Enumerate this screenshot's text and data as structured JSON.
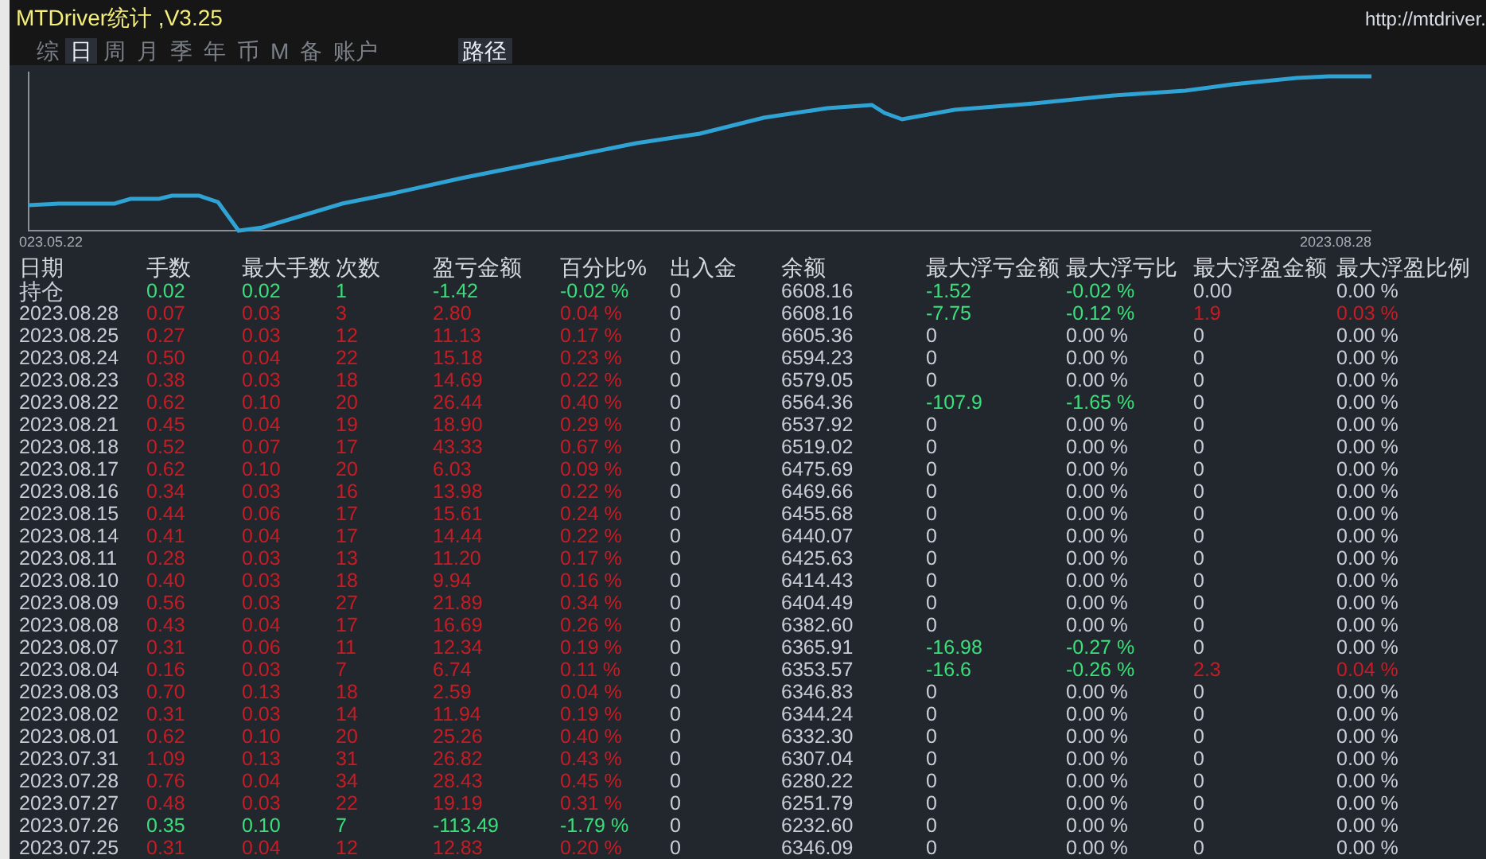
{
  "window": {
    "title": "MTDriver统计 ,V3.25",
    "url": "http://mtdriver."
  },
  "tabs": [
    {
      "label": "综",
      "selected": false
    },
    {
      "label": "日",
      "selected": true
    },
    {
      "label": "周",
      "selected": false
    },
    {
      "label": "月",
      "selected": false
    },
    {
      "label": "季",
      "selected": false
    },
    {
      "label": "年",
      "selected": false
    },
    {
      "label": "币",
      "selected": false
    },
    {
      "label": "M",
      "selected": false
    },
    {
      "label": "备",
      "selected": false
    },
    {
      "label": "账户",
      "selected": false
    }
  ],
  "path_button": "路径",
  "chart": {
    "start_label": "023.05.22",
    "end_label": "2023.08.28"
  },
  "table": {
    "columns": [
      "日期",
      "手数",
      "最大手数",
      "次数",
      "盈亏金额",
      "百分比%",
      "出入金",
      "余额",
      "最大浮亏金额",
      "最大浮亏比",
      "最大浮盈金额",
      "最大浮盈比例"
    ],
    "rows": [
      {
        "cells": [
          "持仓",
          "0.02",
          "0.02",
          "1",
          "-1.42",
          "-0.02 %",
          "0",
          "6608.16",
          "-1.52",
          "-0.02 %",
          "0.00",
          "0.00 %"
        ],
        "loss": true,
        "float_loss": true,
        "float_profit": false
      },
      {
        "cells": [
          "2023.08.28",
          "0.07",
          "0.03",
          "3",
          "2.80",
          "0.04 %",
          "0",
          "6608.16",
          "-7.75",
          "-0.12 %",
          "1.9",
          "0.03 %"
        ],
        "loss": false,
        "float_loss": true,
        "float_profit": true
      },
      {
        "cells": [
          "2023.08.25",
          "0.27",
          "0.03",
          "12",
          "11.13",
          "0.17 %",
          "0",
          "6605.36",
          "0",
          "0.00 %",
          "0",
          "0.00 %"
        ],
        "loss": false,
        "float_loss": false,
        "float_profit": false
      },
      {
        "cells": [
          "2023.08.24",
          "0.50",
          "0.04",
          "22",
          "15.18",
          "0.23 %",
          "0",
          "6594.23",
          "0",
          "0.00 %",
          "0",
          "0.00 %"
        ],
        "loss": false,
        "float_loss": false,
        "float_profit": false
      },
      {
        "cells": [
          "2023.08.23",
          "0.38",
          "0.03",
          "18",
          "14.69",
          "0.22 %",
          "0",
          "6579.05",
          "0",
          "0.00 %",
          "0",
          "0.00 %"
        ],
        "loss": false,
        "float_loss": false,
        "float_profit": false
      },
      {
        "cells": [
          "2023.08.22",
          "0.62",
          "0.10",
          "20",
          "26.44",
          "0.40 %",
          "0",
          "6564.36",
          "-107.9",
          "-1.65 %",
          "0",
          "0.00 %"
        ],
        "loss": false,
        "float_loss": true,
        "float_profit": false
      },
      {
        "cells": [
          "2023.08.21",
          "0.45",
          "0.04",
          "19",
          "18.90",
          "0.29 %",
          "0",
          "6537.92",
          "0",
          "0.00 %",
          "0",
          "0.00 %"
        ],
        "loss": false,
        "float_loss": false,
        "float_profit": false
      },
      {
        "cells": [
          "2023.08.18",
          "0.52",
          "0.07",
          "17",
          "43.33",
          "0.67 %",
          "0",
          "6519.02",
          "0",
          "0.00 %",
          "0",
          "0.00 %"
        ],
        "loss": false,
        "float_loss": false,
        "float_profit": false
      },
      {
        "cells": [
          "2023.08.17",
          "0.62",
          "0.10",
          "20",
          "6.03",
          "0.09 %",
          "0",
          "6475.69",
          "0",
          "0.00 %",
          "0",
          "0.00 %"
        ],
        "loss": false,
        "float_loss": false,
        "float_profit": false
      },
      {
        "cells": [
          "2023.08.16",
          "0.34",
          "0.03",
          "16",
          "13.98",
          "0.22 %",
          "0",
          "6469.66",
          "0",
          "0.00 %",
          "0",
          "0.00 %"
        ],
        "loss": false,
        "float_loss": false,
        "float_profit": false
      },
      {
        "cells": [
          "2023.08.15",
          "0.44",
          "0.06",
          "17",
          "15.61",
          "0.24 %",
          "0",
          "6455.68",
          "0",
          "0.00 %",
          "0",
          "0.00 %"
        ],
        "loss": false,
        "float_loss": false,
        "float_profit": false
      },
      {
        "cells": [
          "2023.08.14",
          "0.41",
          "0.04",
          "17",
          "14.44",
          "0.22 %",
          "0",
          "6440.07",
          "0",
          "0.00 %",
          "0",
          "0.00 %"
        ],
        "loss": false,
        "float_loss": false,
        "float_profit": false
      },
      {
        "cells": [
          "2023.08.11",
          "0.28",
          "0.03",
          "13",
          "11.20",
          "0.17 %",
          "0",
          "6425.63",
          "0",
          "0.00 %",
          "0",
          "0.00 %"
        ],
        "loss": false,
        "float_loss": false,
        "float_profit": false
      },
      {
        "cells": [
          "2023.08.10",
          "0.40",
          "0.03",
          "18",
          "9.94",
          "0.16 %",
          "0",
          "6414.43",
          "0",
          "0.00 %",
          "0",
          "0.00 %"
        ],
        "loss": false,
        "float_loss": false,
        "float_profit": false
      },
      {
        "cells": [
          "2023.08.09",
          "0.56",
          "0.03",
          "27",
          "21.89",
          "0.34 %",
          "0",
          "6404.49",
          "0",
          "0.00 %",
          "0",
          "0.00 %"
        ],
        "loss": false,
        "float_loss": false,
        "float_profit": false
      },
      {
        "cells": [
          "2023.08.08",
          "0.43",
          "0.04",
          "17",
          "16.69",
          "0.26 %",
          "0",
          "6382.60",
          "0",
          "0.00 %",
          "0",
          "0.00 %"
        ],
        "loss": false,
        "float_loss": false,
        "float_profit": false
      },
      {
        "cells": [
          "2023.08.07",
          "0.31",
          "0.06",
          "11",
          "12.34",
          "0.19 %",
          "0",
          "6365.91",
          "-16.98",
          "-0.27 %",
          "0",
          "0.00 %"
        ],
        "loss": false,
        "float_loss": true,
        "float_profit": false
      },
      {
        "cells": [
          "2023.08.04",
          "0.16",
          "0.03",
          "7",
          "6.74",
          "0.11 %",
          "0",
          "6353.57",
          "-16.6",
          "-0.26 %",
          "2.3",
          "0.04 %"
        ],
        "loss": false,
        "float_loss": true,
        "float_profit": true
      },
      {
        "cells": [
          "2023.08.03",
          "0.70",
          "0.13",
          "18",
          "2.59",
          "0.04 %",
          "0",
          "6346.83",
          "0",
          "0.00 %",
          "0",
          "0.00 %"
        ],
        "loss": false,
        "float_loss": false,
        "float_profit": false
      },
      {
        "cells": [
          "2023.08.02",
          "0.31",
          "0.03",
          "14",
          "11.94",
          "0.19 %",
          "0",
          "6344.24",
          "0",
          "0.00 %",
          "0",
          "0.00 %"
        ],
        "loss": false,
        "float_loss": false,
        "float_profit": false
      },
      {
        "cells": [
          "2023.08.01",
          "0.62",
          "0.10",
          "20",
          "25.26",
          "0.40 %",
          "0",
          "6332.30",
          "0",
          "0.00 %",
          "0",
          "0.00 %"
        ],
        "loss": false,
        "float_loss": false,
        "float_profit": false
      },
      {
        "cells": [
          "2023.07.31",
          "1.09",
          "0.13",
          "31",
          "26.82",
          "0.43 %",
          "0",
          "6307.04",
          "0",
          "0.00 %",
          "0",
          "0.00 %"
        ],
        "loss": false,
        "float_loss": false,
        "float_profit": false
      },
      {
        "cells": [
          "2023.07.28",
          "0.76",
          "0.04",
          "34",
          "28.43",
          "0.45 %",
          "0",
          "6280.22",
          "0",
          "0.00 %",
          "0",
          "0.00 %"
        ],
        "loss": false,
        "float_loss": false,
        "float_profit": false
      },
      {
        "cells": [
          "2023.07.27",
          "0.48",
          "0.03",
          "22",
          "19.19",
          "0.31 %",
          "0",
          "6251.79",
          "0",
          "0.00 %",
          "0",
          "0.00 %"
        ],
        "loss": false,
        "float_loss": false,
        "float_profit": false
      },
      {
        "cells": [
          "2023.07.26",
          "0.35",
          "0.10",
          "7",
          "-113.49",
          "-1.79 %",
          "0",
          "6232.60",
          "0",
          "0.00 %",
          "0",
          "0.00 %"
        ],
        "loss": true,
        "float_loss": false,
        "float_profit": false
      },
      {
        "cells": [
          "2023.07.25",
          "0.31",
          "0.04",
          "12",
          "12.83",
          "0.20 %",
          "0",
          "6346.09",
          "0",
          "0.00 %",
          "0",
          "0.00 %"
        ],
        "loss": false,
        "float_loss": false,
        "float_profit": false
      }
    ]
  }
}
